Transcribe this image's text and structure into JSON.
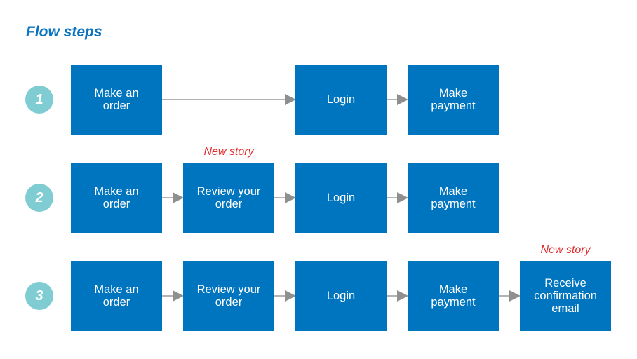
{
  "title": "Flow steps",
  "colors": {
    "box": "#0075bf",
    "circle": "#7fccd3",
    "tag": "#e32b2b",
    "title": "#0b74bf",
    "arrow": "#9e9e9e"
  },
  "rows": [
    {
      "number": "1",
      "steps": [
        "Make an\norder",
        "",
        "Login",
        "Make\npayment"
      ],
      "new_story_index": null
    },
    {
      "number": "2",
      "steps": [
        "Make an\norder",
        "Review your\norder",
        "Login",
        "Make\npayment"
      ],
      "new_story_index": 1
    },
    {
      "number": "3",
      "steps": [
        "Make an\norder",
        "Review your\norder",
        "Login",
        "Make\npayment",
        "Receive\nconfirmation\nemail"
      ],
      "new_story_index": 4
    }
  ],
  "new_story_label": "New story"
}
